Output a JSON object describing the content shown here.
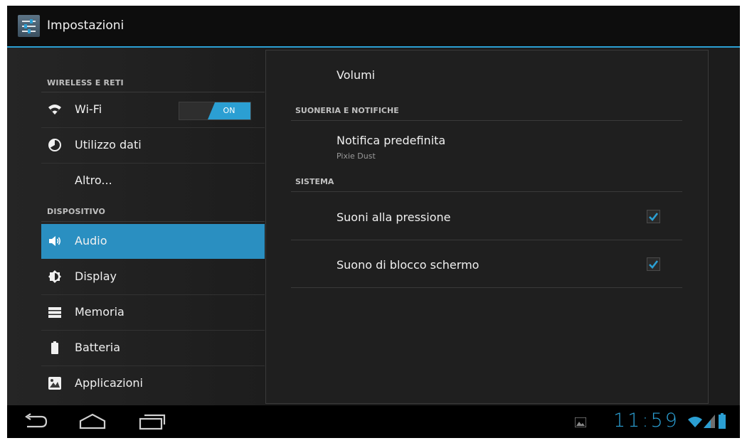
{
  "app": {
    "title": "Impostazioni",
    "icon": "settings-sliders-icon"
  },
  "sidebar": {
    "sections": [
      {
        "header": "WIRELESS E RETI"
      },
      {
        "header": "DISPOSITIVO"
      }
    ],
    "items": [
      {
        "label": "Wi-Fi",
        "icon": "wifi-icon",
        "toggle": "ON",
        "toggle_on": true
      },
      {
        "label": "Utilizzo dati",
        "icon": "data-usage-icon"
      },
      {
        "label": "Altro..."
      },
      {
        "label": "Audio",
        "icon": "speaker-icon",
        "selected": true
      },
      {
        "label": "Display",
        "icon": "brightness-icon"
      },
      {
        "label": "Memoria",
        "icon": "storage-icon"
      },
      {
        "label": "Batteria",
        "icon": "battery-icon"
      },
      {
        "label": "Applicazioni",
        "icon": "apps-icon"
      }
    ]
  },
  "detail": {
    "volumes": {
      "title": "Volumi"
    },
    "section_ringtone": "SUONERIA E NOTIFICHE",
    "default_notification": {
      "title": "Notifica predefinita",
      "subtitle": "Pixie Dust"
    },
    "section_system": "SISTEMA",
    "touch_sounds": {
      "title": "Suoni alla pressione",
      "checked": true
    },
    "lock_sound": {
      "title": "Suono di blocco schermo",
      "checked": true
    }
  },
  "navbar": {
    "buttons": [
      "back-icon",
      "home-icon",
      "recent-apps-icon"
    ],
    "clock": "11:59",
    "status_icons": [
      "gallery-notification-icon",
      "wifi-signal-icon",
      "cell-signal-icon",
      "battery-status-icon"
    ]
  },
  "colors": {
    "accent": "#2b9fd3",
    "selected": "#2a8fc1",
    "background": "#1c1c1c"
  }
}
